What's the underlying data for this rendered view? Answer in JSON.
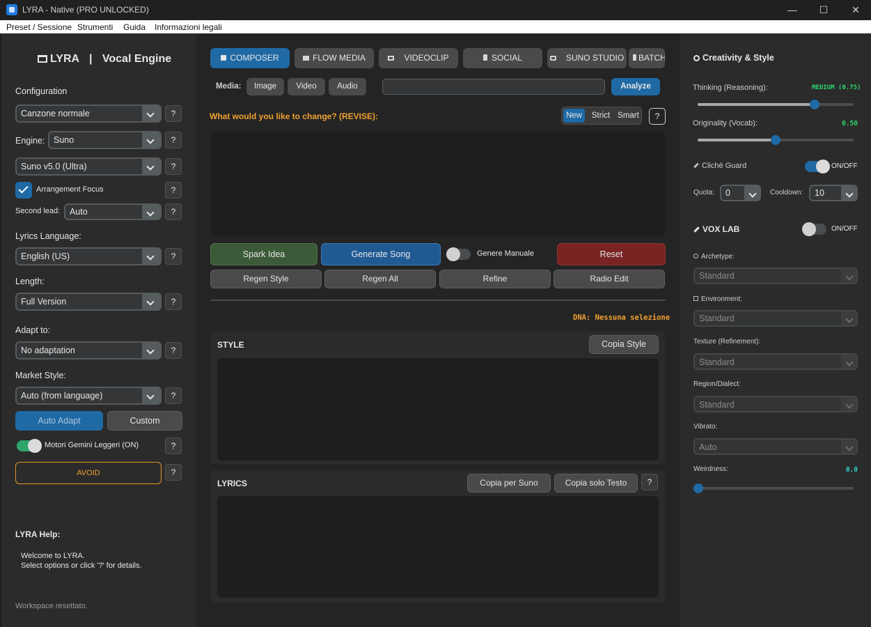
{
  "window": {
    "title": "LYRA - Native (PRO UNLOCKED)",
    "controls": [
      "—",
      "☐",
      "✕"
    ]
  },
  "menu": [
    "Preset / Sessione",
    "Strumenti",
    "Guida",
    "Informazioni legali"
  ],
  "left": {
    "logo": "LYRA",
    "separator": "|",
    "subtitle": "Vocal Engine",
    "configuration_label": "Configuration",
    "song_type": "Canzone normale",
    "engine_label": "Engine:",
    "engine": "Suno",
    "model": "Suno v5.0 (Ultra)",
    "arrangement_focus": "Arrangement Focus",
    "second_lead_label": "Second lead:",
    "second_lead": "Auto",
    "lyrics_language_label": "Lyrics Language:",
    "lyrics_language": "English (US)",
    "length_label": "Length:",
    "length": "Full Version",
    "adapt_label": "Adapt to:",
    "adapt": "No adaptation",
    "market_label": "Market Style:",
    "market": "Auto (from language)",
    "auto_adapt": "Auto Adapt",
    "custom": "Custom",
    "gemini_toggle": "Motori Gemini Leggeri (ON)",
    "avoid": "AVOID",
    "help_title": "LYRA Help:",
    "help_line1": "Welcome to LYRA.",
    "help_line2": "Select options or click '?' for details.",
    "status": "Workspace resettato.",
    "q": "?"
  },
  "center": {
    "tabs": [
      "COMPOSER",
      "FLOW MEDIA",
      "VIDEOCLIP",
      "SOCIAL",
      "SUNO STUDIO",
      "BATCH"
    ],
    "media_label": "Media:",
    "media_buttons": [
      "Image",
      "Video",
      "Audio"
    ],
    "analyze": "Analyze",
    "revise_label": "What would you like to change? (REVISE):",
    "modes": [
      "New",
      "Strict",
      "Smart"
    ],
    "spark": "Spark Idea",
    "generate": "Generate Song",
    "genre_manual": "Genere Manuale",
    "reset": "Reset",
    "regen_style": "Regen Style",
    "regen_all": "Regen All",
    "refine": "Refine",
    "radio_edit": "Radio Edit",
    "dna": "DNA: Nessuna selezione",
    "style_title": "STYLE",
    "copy_style": "Copia Style",
    "lyrics_title": "LYRICS",
    "copy_suno": "Copia per Suno",
    "copy_text": "Copia solo Testo",
    "q": "?"
  },
  "right": {
    "creativity_title": "Creativity & Style",
    "thinking_label": "Thinking (Reasoning):",
    "thinking_value": "MEDIUM (0.75)",
    "thinking_level": 0.75,
    "originality_label": "Originality (Vocab):",
    "originality_value": "0.50",
    "originality_level": 0.5,
    "cliche_label": "Cliché Guard",
    "onoff": "ON/OFF",
    "quota_label": "Quota:",
    "quota": "0",
    "cooldown_label": "Cooldown:",
    "cooldown": "10",
    "vox_title": "VOX LAB",
    "archetype_label": "Archetype:",
    "archetype": "Standard",
    "environment_label": "Environment:",
    "environment": "Standard",
    "texture_label": "Texture (Refinement):",
    "texture": "Standard",
    "region_label": "Region/Dialect:",
    "region": "Standard",
    "vibrato_label": "Vibrato:",
    "vibrato": "Auto",
    "weirdness_label": "Weirdness:",
    "weirdness_value": "0.0",
    "weirdness_level": 0.0
  },
  "colors": {
    "accent_blue": "#1f6aa5",
    "green_btn": "#3b5a37",
    "red_btn": "#7a2323",
    "orange": "#f0a030",
    "green_text": "#2bd96b"
  }
}
